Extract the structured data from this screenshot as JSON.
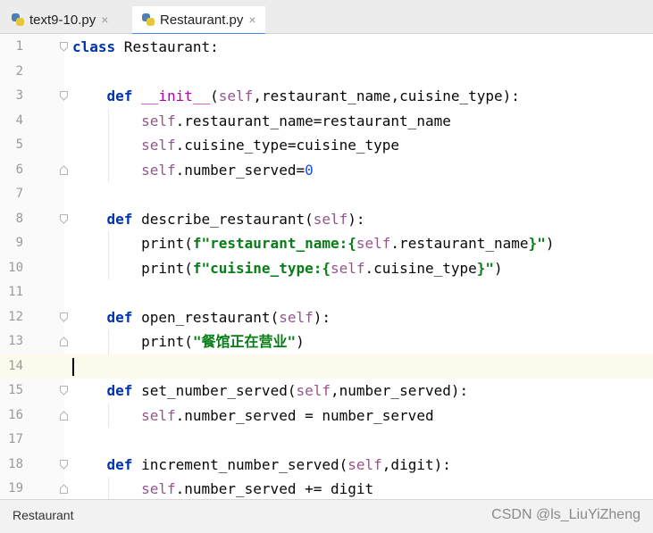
{
  "tabs": [
    {
      "label": "text9-10.py",
      "close": "×"
    },
    {
      "label": "Restaurant.py",
      "close": "×"
    }
  ],
  "lines": [
    "class Restaurant:",
    "",
    "    def __init__(self,restaurant_name,cuisine_type):",
    "        self.restaurant_name=restaurant_name",
    "        self.cuisine_type=cuisine_type",
    "        self.number_served=0",
    "",
    "    def describe_restaurant(self):",
    "        print(f\"restaurant_name:{self.restaurant_name}\")",
    "        print(f\"cuisine_type:{self.cuisine_type}\")",
    "",
    "    def open_restaurant(self):",
    "        print(\"餐馆正在营业\")",
    "",
    "    def set_number_served(self,number_served):",
    "        self.number_served = number_served",
    "",
    "    def increment_number_served(self,digit):",
    "        self.number_served += digit"
  ],
  "line_numbers": [
    "1",
    "2",
    "3",
    "4",
    "5",
    "6",
    "7",
    "8",
    "9",
    "10",
    "11",
    "12",
    "13",
    "14",
    "15",
    "16",
    "17",
    "18",
    "19"
  ],
  "current_line": 14,
  "status": {
    "breadcrumb": "Restaurant"
  },
  "watermark": "CSDN @ls_LiuYiZheng",
  "colors": {
    "keyword": "#0033b3",
    "self": "#94558d",
    "string": "#067d17",
    "number": "#1750eb",
    "current_line": "#fcfaed"
  }
}
